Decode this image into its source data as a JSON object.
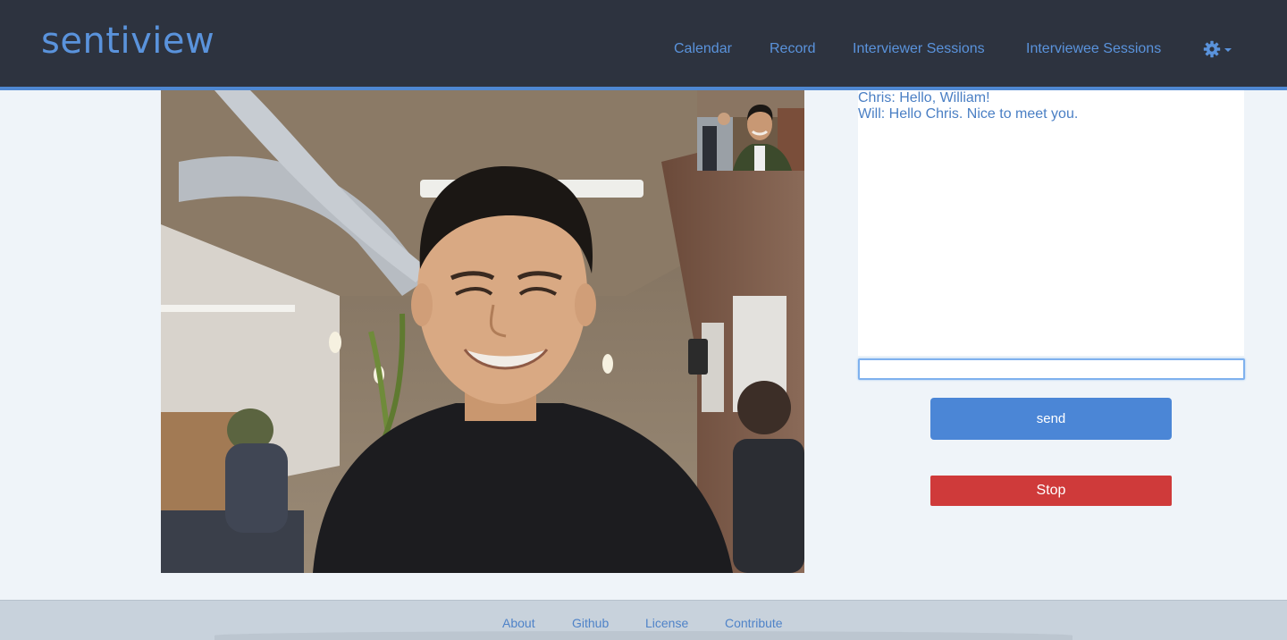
{
  "header": {
    "brand": "sentiview",
    "nav": [
      {
        "label": "Calendar"
      },
      {
        "label": "Record"
      },
      {
        "label": "Interviewer Sessions"
      },
      {
        "label": "Interviewee Sessions"
      }
    ],
    "settings_icon": "gear-icon",
    "dropdown_icon": "caret-down-icon"
  },
  "video": {
    "main": "remote-video",
    "pip": "local-video"
  },
  "chat": {
    "messages": [
      {
        "text": "Chris: Hello, William!"
      },
      {
        "text": "Will: Hello Chris. Nice to meet you."
      }
    ],
    "input_value": "",
    "send_label": "send",
    "stop_label": "Stop"
  },
  "footer": {
    "links": [
      {
        "label": "About"
      },
      {
        "label": "Github"
      },
      {
        "label": "License"
      },
      {
        "label": "Contribute"
      }
    ]
  },
  "colors": {
    "navbar": "#2d333f",
    "accent": "#5a93dc",
    "send": "#4b86d6",
    "stop": "#cf3a3a",
    "page": "#eff4f9"
  }
}
